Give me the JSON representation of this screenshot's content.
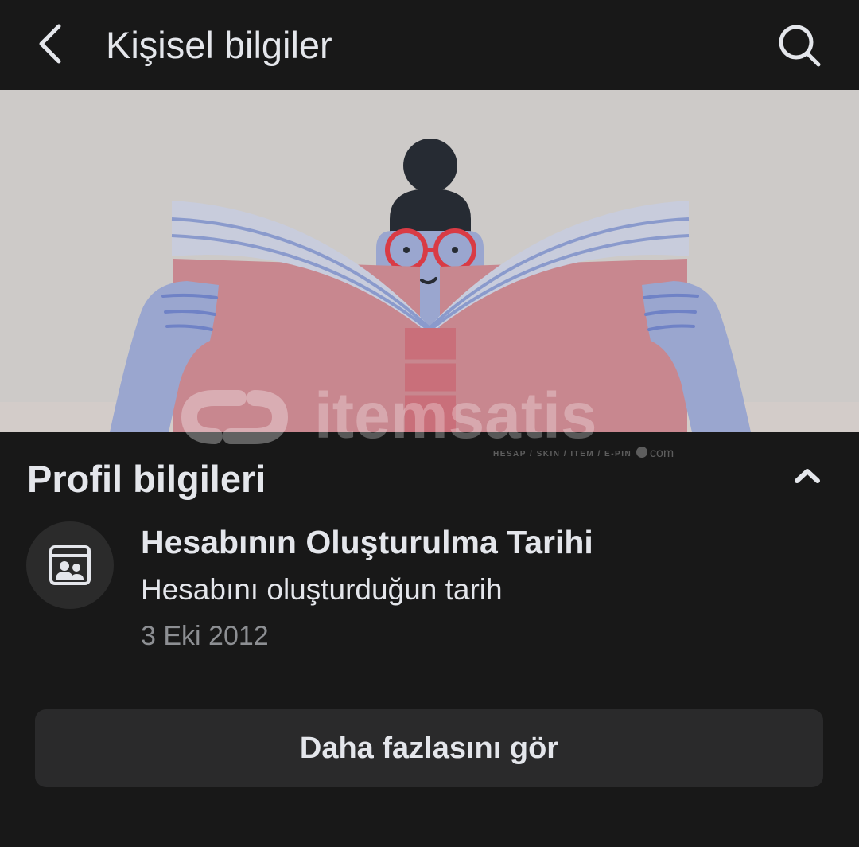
{
  "header": {
    "title": "Kişisel bilgiler",
    "back_icon": "chevron-left-icon",
    "search_icon": "search-icon"
  },
  "banner": {
    "illustration": "person-reading-book",
    "watermark_logo": "itemsatis",
    "watermark_tagline": "HESAP / SKIN / ITEM / E-PIN",
    "watermark_suffix": "com"
  },
  "section": {
    "title": "Profil bilgileri",
    "collapse_icon": "chevron-up-icon"
  },
  "info": {
    "icon": "profile-card-icon",
    "heading": "Hesabının Oluşturulma Tarihi",
    "description": "Hesabını oluşturduğun tarih",
    "date": "3 Eki 2012"
  },
  "more_button": {
    "label": "Daha fazlasını gör"
  },
  "colors": {
    "background": "#181818",
    "surface": "#2a2a2b",
    "text": "#e4e6eb",
    "secondary_text": "#8d8f93"
  }
}
